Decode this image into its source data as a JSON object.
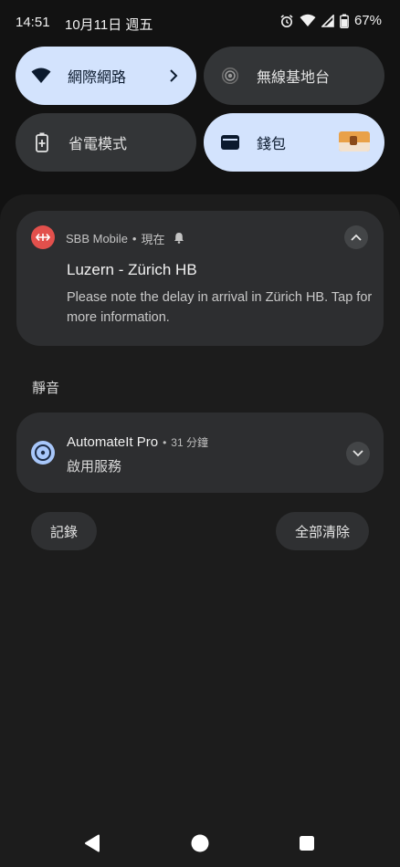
{
  "status_bar": {
    "time": "14:51",
    "date": "10月11日 週五",
    "battery": "67%"
  },
  "tiles": {
    "internet": {
      "label": "網際網路"
    },
    "hotspot": {
      "label": "無線基地台"
    },
    "battery_saver": {
      "label": "省電模式"
    },
    "wallet": {
      "label": "錢包"
    }
  },
  "notification_sbb": {
    "app": "SBB Mobile",
    "separator": "•",
    "time": "現在",
    "title": "Luzern - Zürich HB",
    "body": "Please note the delay in arrival in Zürich HB. Tap for more information."
  },
  "silent_header": "靜音",
  "notification_automateit": {
    "app": "AutomateIt Pro",
    "separator": "•",
    "time": "31 分鐘",
    "text": "啟用服務"
  },
  "actions": {
    "history": "記錄",
    "clear_all": "全部清除"
  },
  "colors": {
    "sbb_red": "#e2504c",
    "tile_on": "#d3e3fd",
    "tile_off": "#333537",
    "card": "#2d2e30"
  },
  "icons": {
    "wifi": "wifi-icon",
    "chevron": "chevron-right-icon",
    "hotspot": "hotspot-icon",
    "battery_saver": "battery-saver-icon",
    "wallet": "wallet-icon",
    "alarm": "alarm-icon",
    "signal": "signal-icon",
    "battery": "battery-icon",
    "sbb": "sbb-logo-icon",
    "bell": "bell-icon",
    "collapse": "chevron-up-icon",
    "automateit": "automateit-icon",
    "expand": "chevron-down-icon",
    "back": "back-icon",
    "home": "home-icon",
    "recents": "recents-icon"
  }
}
